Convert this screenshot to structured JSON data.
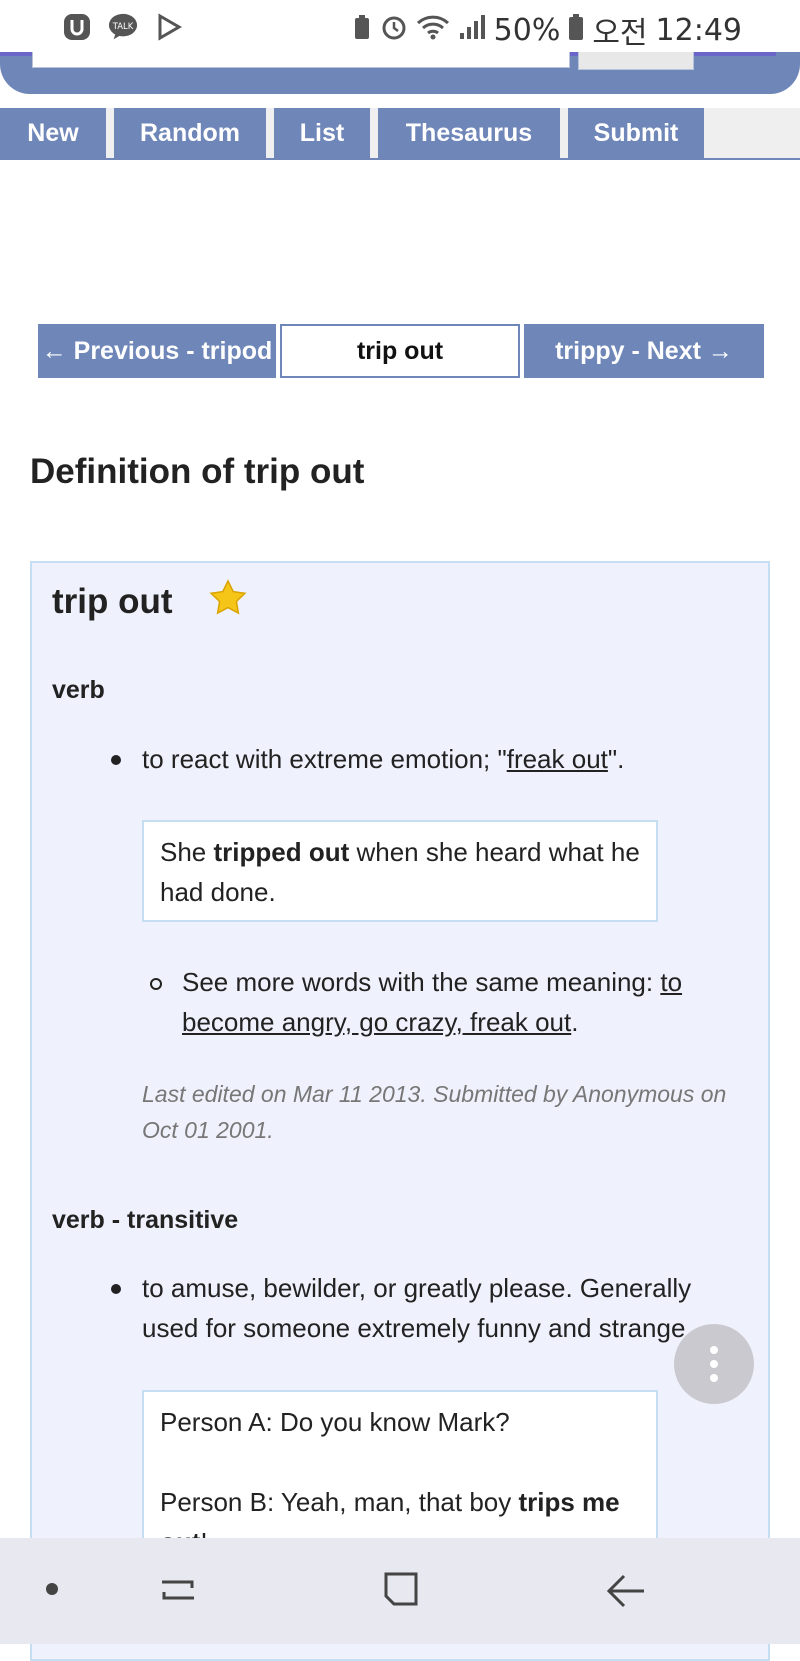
{
  "status_bar": {
    "battery": "50%",
    "ampm": "오전",
    "time": "12:49",
    "icons": [
      "u-app-icon",
      "kakaotalk-icon",
      "play-store-icon",
      "battery-saver-icon",
      "alarm-icon",
      "wifi-icon",
      "signal-icon",
      "battery-icon"
    ]
  },
  "nav": {
    "tabs": [
      {
        "label": "New"
      },
      {
        "label": "Random"
      },
      {
        "label": "List"
      },
      {
        "label": "Thesaurus"
      },
      {
        "label": "Submit"
      }
    ]
  },
  "word_nav": {
    "previous": "← Previous - tripod",
    "current": "trip out",
    "next": "trippy - Next →"
  },
  "page_title": "Definition of trip out",
  "entry": {
    "word": "trip out",
    "sense1": {
      "part_of_speech": "verb",
      "definition_prefix": "to react with extreme emotion; \"",
      "definition_link": "freak out",
      "definition_suffix": "\".",
      "example_before": "She ",
      "example_bold": "tripped out",
      "example_after": " when she heard what he had done.",
      "see_more_prefix": "See more words with the same meaning: ",
      "see_more_link": "to become angry, go crazy, freak out",
      "see_more_suffix": ".",
      "meta": "Last edited on Mar 11 2013. Submitted by Anonymous on Oct 01 2001."
    },
    "sense2": {
      "part_of_speech": "verb - transitive",
      "definition": "to amuse, bewilder, or greatly please. Generally used for someone extremely funny and strange.",
      "example_line1": "Person A: Do you know Mark?",
      "example_line2_before": "Person B: Yeah, man, that boy ",
      "example_line2_bold": "trips me out",
      "example_line2_after": "!"
    }
  },
  "colors": {
    "accent": "#6f86b8",
    "card_bg": "#eff1fc",
    "card_border": "#c6def2"
  }
}
